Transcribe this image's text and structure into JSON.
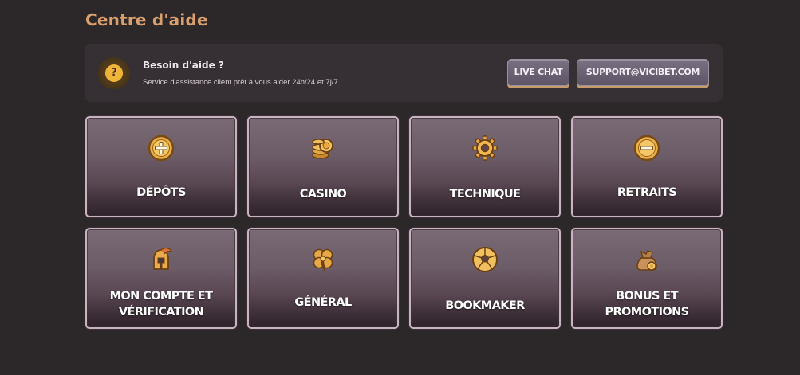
{
  "page": {
    "title": "Centre d'aide"
  },
  "help": {
    "icon": "question-icon",
    "icon_glyph": "?",
    "title": "Besoin d'aide ?",
    "subtitle": "Service d'assistance client prêt à vous aider 24h/24 et 7j/7.",
    "live_chat_label": "LIVE CHAT",
    "support_label": "SUPPORT@VICIBET.COM"
  },
  "categories": [
    {
      "label": "DÉPÔTS",
      "icon": "plus-icon"
    },
    {
      "label": "CASINO",
      "icon": "chips-icon"
    },
    {
      "label": "TECHNIQUE",
      "icon": "gear-icon"
    },
    {
      "label": "RETRAITS",
      "icon": "minus-icon"
    },
    {
      "label": "MON COMPTE ET VÉRIFICATION",
      "icon": "helmet-icon"
    },
    {
      "label": "GÉNÉRAL",
      "icon": "clover-icon"
    },
    {
      "label": "BOOKMAKER",
      "icon": "football-icon"
    },
    {
      "label": "BONUS ET PROMOTIONS",
      "icon": "money-bag-icon"
    }
  ],
  "colors": {
    "background": "#2c2729",
    "accent_gold": "#d9a06e",
    "icon_gold": "#f0b43a",
    "card_border": "#c7b4c0"
  }
}
